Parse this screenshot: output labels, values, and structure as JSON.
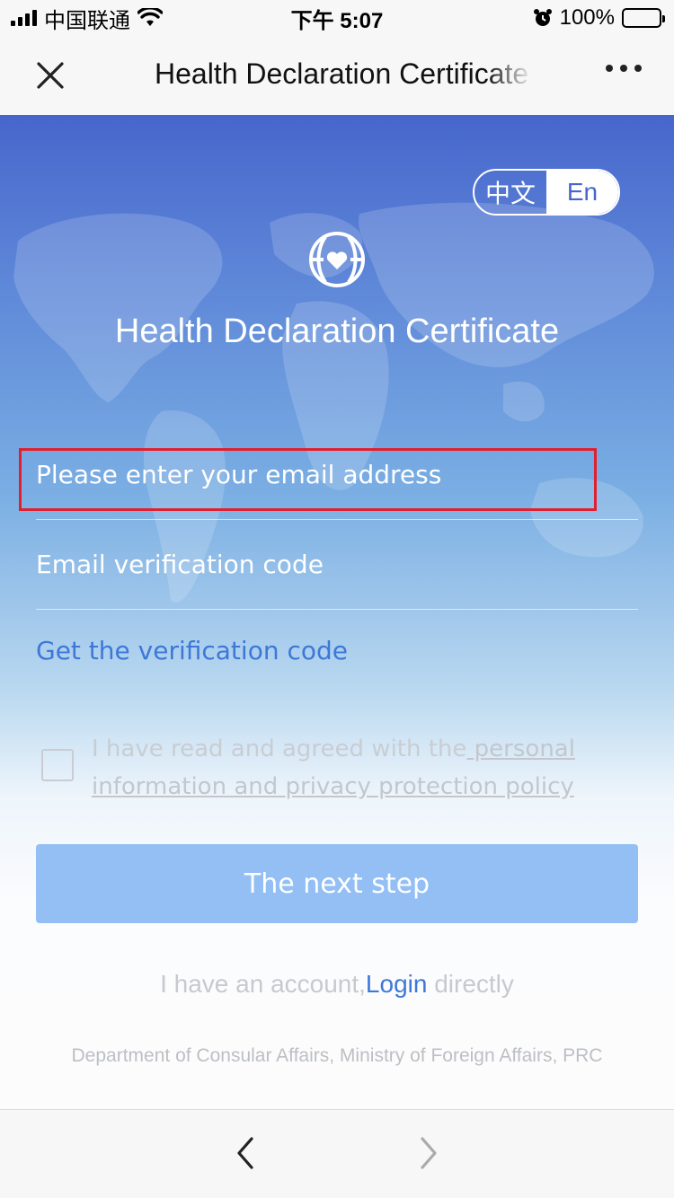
{
  "status_bar": {
    "carrier": "中国联通",
    "time": "下午 5:07",
    "battery": "100%",
    "icons": [
      "signal-icon",
      "wifi-icon",
      "alarm-icon",
      "battery-icon"
    ]
  },
  "nav": {
    "title": "Health Declaration Certificate",
    "close_icon": "close-icon",
    "more_icon": "more-icon"
  },
  "lang_toggle": {
    "zh": "中文",
    "en": "En",
    "selected": "En"
  },
  "hero": {
    "logo_icon": "globe-heart-icon",
    "title": "Health Declaration Certificate"
  },
  "form": {
    "email_placeholder": "Please enter your email address",
    "code_placeholder": "Email verification code",
    "get_code_link": "Get the verification code",
    "agree_prefix": "I have read and agreed with the",
    "agree_link": " personal information and privacy protection policy",
    "agree_checked": false,
    "next_button": "The next step"
  },
  "login_line": {
    "prefix": "I have an account,",
    "link": "Login",
    "suffix": " directly"
  },
  "footer": "Department of Consular Affairs, Ministry of Foreign Affairs, PRC",
  "bottom_bar": {
    "back_icon": "chevron-left-icon",
    "forward_icon": "chevron-right-icon"
  },
  "colors": {
    "header_blue": "#4766cc",
    "link_blue": "#3d78d8",
    "button_blue": "#93bff4",
    "highlight_red": "#e0202e"
  }
}
